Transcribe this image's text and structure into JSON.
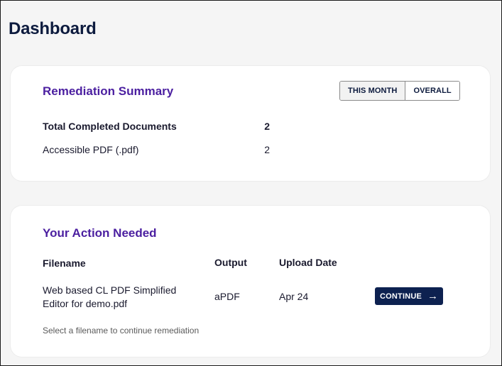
{
  "page": {
    "title": "Dashboard"
  },
  "summary": {
    "title": "Remediation Summary",
    "toggle": {
      "this_month": "THIS MONTH",
      "overall": "OVERALL"
    },
    "rows": [
      {
        "label": "Total Completed Documents",
        "value": "2"
      },
      {
        "label": "Accessible PDF (.pdf)",
        "value": "2"
      }
    ]
  },
  "action": {
    "title": "Your Action Needed",
    "headers": {
      "filename": "Filename",
      "output": "Output",
      "upload_date": "Upload Date"
    },
    "rows": [
      {
        "filename": "Web based CL PDF Simplified Editor for demo.pdf",
        "output": "aPDF",
        "upload_date": "Apr 24",
        "button_label": "CONTINUE"
      }
    ],
    "hint": "Select a filename to continue remediation"
  },
  "icons": {
    "continue_arrow": "arrow-right-icon"
  },
  "colors": {
    "accent": "#4b1fa0",
    "button_bg": "#0d2150",
    "title": "#0d1b3e"
  }
}
